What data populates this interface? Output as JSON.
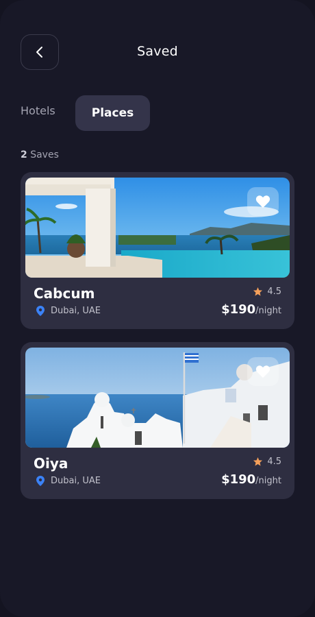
{
  "header": {
    "title": "Saved",
    "back_icon": "chevron-left-icon"
  },
  "tabs": [
    {
      "label": "Hotels",
      "active": false
    },
    {
      "label": "Places",
      "active": true
    }
  ],
  "saves": {
    "count": "2",
    "label": "Saves"
  },
  "places": [
    {
      "name": "Cabcum",
      "location": "Dubai, UAE",
      "rating": "4.5",
      "price": "$190",
      "price_unit": "/night",
      "favorite_icon": "heart-icon",
      "image": "infinity pool overlooking sea"
    },
    {
      "name": "Oiya",
      "location": "Dubai, UAE",
      "rating": "4.5",
      "price": "$190",
      "price_unit": "/night",
      "favorite_icon": "heart-icon",
      "image": "whitewashed church by the sea"
    }
  ],
  "colors": {
    "background": "#181827",
    "card": "#2e2e41",
    "active_tab": "#34344a",
    "star": "#f5a05a",
    "pin": "#3b82f6"
  }
}
